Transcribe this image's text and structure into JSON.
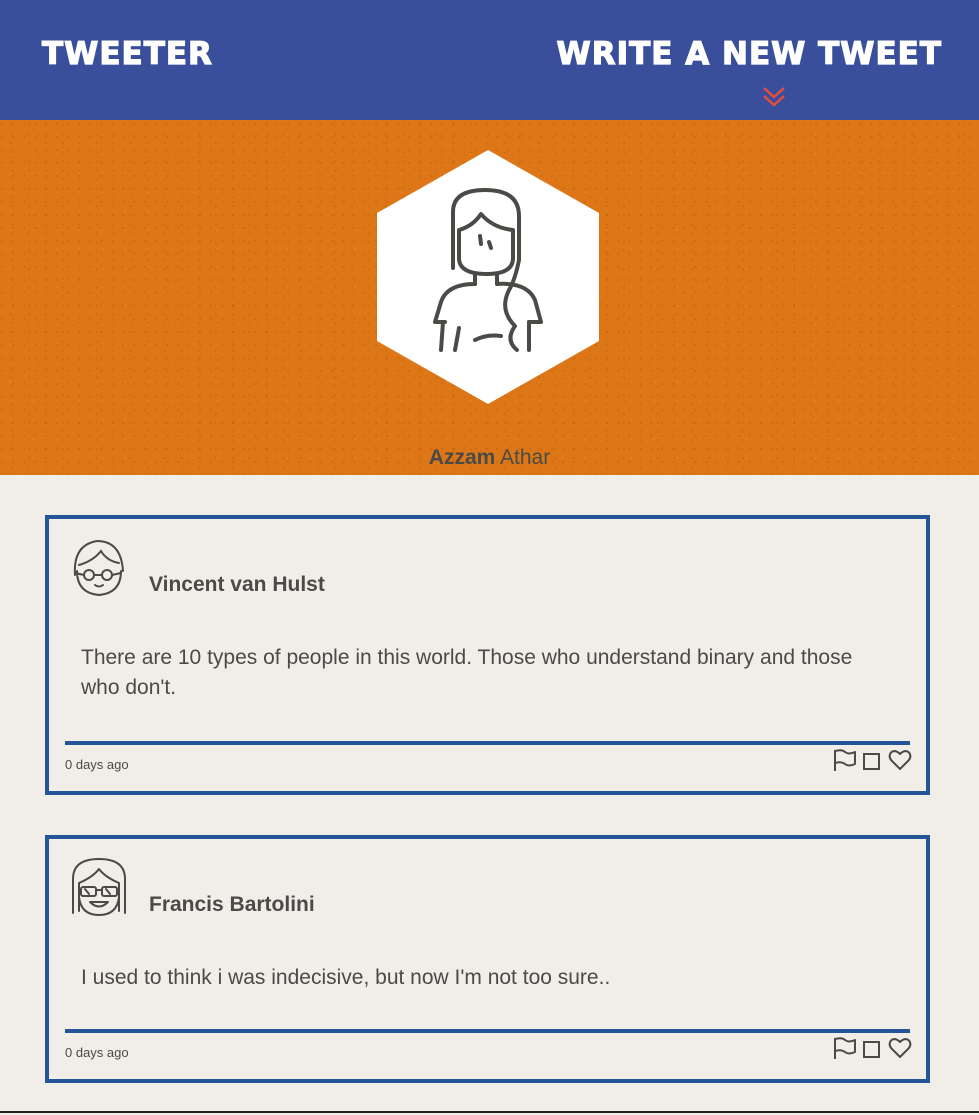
{
  "header": {
    "brand": "TWEETER",
    "compose_label": "WRITE A NEW TWEET",
    "compose_icon": "double-chevron-down-icon",
    "chevron_color": "#e94b3c"
  },
  "profile": {
    "first_name": "Azzam",
    "last_name": "Athar",
    "avatar_icon": "female-avatar-icon"
  },
  "colors": {
    "header_bg": "#3a4f9b",
    "hero_bg": "#dd7617",
    "page_bg": "#f1eee9",
    "tweet_border": "#245596",
    "text": "#4a4a46"
  },
  "tweets": [
    {
      "author": "Vincent van Hulst",
      "avatar_icon": "glasses-man-avatar-icon",
      "text": "There are 10 types of people in this world. Those who understand binary and those who don't.",
      "time": "0 days ago",
      "actions": [
        "flag-icon",
        "retweet-icon",
        "heart-icon"
      ]
    },
    {
      "author": "Francis Bartolini",
      "avatar_icon": "sunglasses-avatar-icon",
      "text": "I used to think i was indecisive, but now I'm not too sure..",
      "time": "0 days ago",
      "actions": [
        "flag-icon",
        "retweet-icon",
        "heart-icon"
      ]
    }
  ]
}
